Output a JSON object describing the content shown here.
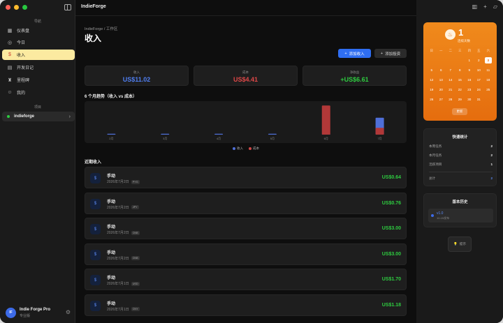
{
  "app": {
    "title": "IndieForge"
  },
  "sidebar": {
    "section_nav": "导航",
    "items": [
      {
        "label": "仪表盘",
        "icon": "dashboard-icon"
      },
      {
        "label": "今日",
        "icon": "check-circle-icon"
      },
      {
        "label": "收入",
        "icon": "dollar-icon",
        "active": true
      },
      {
        "label": "开发日记",
        "icon": "book-icon"
      },
      {
        "label": "里程碑",
        "icon": "trophy-icon"
      },
      {
        "label": "我的",
        "icon": "user-icon"
      }
    ],
    "section_projects": "项目",
    "project": {
      "name": "indieforge",
      "status_color": "#2ecc40"
    },
    "user": {
      "initials": "IF",
      "name": "Indie Forge Pro",
      "plan": "专业版"
    }
  },
  "main": {
    "breadcrumb": "IndieForge / 工作区",
    "title": "收入",
    "add_income_label": "添加收入",
    "add_investment_label": "添加投资",
    "stats": [
      {
        "label": "收入",
        "value": "US$11.02",
        "color": "#4f7ef0"
      },
      {
        "label": "成本",
        "value": "US$4.41",
        "color": "#e04848"
      },
      {
        "label": "净收益",
        "value": "+US$6.61",
        "color": "#2ecc40"
      }
    ],
    "trend_title": "6 个月趋势（收入 vs 成本）",
    "legend_income": "收入",
    "legend_cost": "成本",
    "recent_title": "近期收入",
    "transactions": [
      {
        "title": "手动",
        "date": "2026年7月2日",
        "tag": "PYG",
        "amount": "US$0.64"
      },
      {
        "title": "手动",
        "date": "2026年7月2日",
        "tag": "JPY",
        "amount": "US$0.76"
      },
      {
        "title": "手动",
        "date": "2026年7月2日",
        "tag": "CNB",
        "amount": "US$3.00"
      },
      {
        "title": "手动",
        "date": "2026年7月2日",
        "tag": "CNB",
        "amount": "US$3.00"
      },
      {
        "title": "手动",
        "date": "2026年7月1日",
        "tag": "USD",
        "amount": "US$1.70"
      },
      {
        "title": "手动",
        "date": "2026年7月1日",
        "tag": "CNY",
        "amount": "US$1.18"
      }
    ]
  },
  "chart_data": {
    "type": "bar",
    "categories": [
      "2月",
      "3月",
      "4月",
      "5月",
      "6月",
      "7月"
    ],
    "series": [
      {
        "name": "收入",
        "color": "#4f6fd8",
        "values": [
          0,
          0,
          0,
          0,
          0,
          11.02
        ]
      },
      {
        "name": "成本",
        "color": "#b13838",
        "values": [
          0,
          0,
          0,
          0,
          19,
          4.41
        ]
      }
    ],
    "ylim": [
      0,
      20
    ]
  },
  "right": {
    "streak_count": "1",
    "streak_label": "连续天数",
    "weekday_headers": [
      "日",
      "一",
      "二",
      "三",
      "四",
      "五",
      "六"
    ],
    "calendar_rows": [
      [
        "",
        "",
        "",
        "",
        "1",
        "2",
        "3"
      ],
      [
        "5",
        "6",
        "7",
        "8",
        "9",
        "10",
        "11"
      ],
      [
        "12",
        "13",
        "14",
        "15",
        "16",
        "17",
        "18"
      ],
      [
        "19",
        "20",
        "21",
        "22",
        "23",
        "24",
        "25"
      ],
      [
        "26",
        "27",
        "28",
        "29",
        "30",
        "31",
        ""
      ]
    ],
    "today": "3",
    "calendar_button": "更新",
    "quick_stats_title": "快速统计",
    "quick_stats": [
      {
        "label": "本周任务",
        "value": "2"
      },
      {
        "label": "本月任务",
        "value": "2"
      },
      {
        "label": "活跃项目",
        "value": "1"
      }
    ],
    "quick_total": {
      "label": "总计",
      "value": "2"
    },
    "version_title": "版本历史",
    "version": {
      "tag": "v1.0",
      "date": "10-15发布"
    },
    "tip_label": "提示"
  }
}
